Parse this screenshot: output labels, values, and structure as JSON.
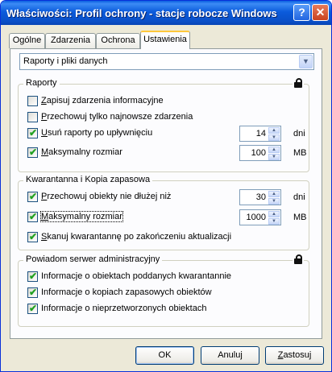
{
  "window": {
    "title": "Właściwości: Profil ochrony - stacje robocze Windows",
    "help_symbol": "?",
    "close_symbol": "✕"
  },
  "tabs": [
    {
      "label": "Ogólne"
    },
    {
      "label": "Zdarzenia"
    },
    {
      "label": "Ochrona"
    },
    {
      "label": "Ustawienia",
      "active": true
    }
  ],
  "category_select": {
    "value": "Raporty i pliki danych"
  },
  "reports": {
    "title": "Raporty",
    "items": [
      {
        "label": "Zapisuj zdarzenia informacyjne",
        "checked": false
      },
      {
        "label": "Przechowuj tylko najnowsze zdarzenia",
        "checked": false
      },
      {
        "label": "Usuń raporty po upływnięciu",
        "checked": true,
        "value": "14",
        "unit": "dni"
      },
      {
        "label": "Maksymalny rozmiar",
        "checked": true,
        "value": "100",
        "unit": "MB"
      }
    ]
  },
  "quarantine": {
    "title": "Kwarantanna i Kopia zapasowa",
    "items": [
      {
        "label": "Przechowuj obiekty nie dłużej niż",
        "checked": true,
        "value": "30",
        "unit": "dni"
      },
      {
        "label": "Maksymalny rozmiar",
        "checked": true,
        "value": "1000",
        "unit": "MB"
      },
      {
        "label": "Skanuj kwarantannę po zakończeniu aktualizacji",
        "checked": true
      }
    ]
  },
  "notify": {
    "title": "Powiadom serwer administracyjny",
    "items": [
      {
        "label": "Informacje o obiektach poddanych kwarantannie",
        "checked": true
      },
      {
        "label": "Informacje o kopiach zapasowych obiektów",
        "checked": true
      },
      {
        "label": "Informacje o nieprzetworzonych obiektach",
        "checked": true
      }
    ]
  },
  "buttons": {
    "ok": "OK",
    "cancel": "Anuluj",
    "apply": "Zastosuj"
  },
  "check_mark": "✔",
  "colors": {
    "titlebar": "#0a5fe0",
    "active_tab_accent": "#ffc83c",
    "checkmark": "#21a121"
  }
}
